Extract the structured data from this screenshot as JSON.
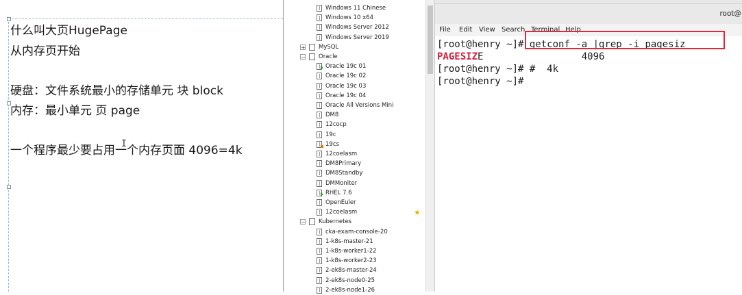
{
  "notes": {
    "lines": [
      "什么叫大页HugePage",
      "从内存页开始",
      "硬盘：文件系统最小的存储单元 块 block",
      "内存：最小单元 页 page",
      "一个程序最少要占用一个内存页面 4096=4k"
    ],
    "cursor_glyph": "I"
  },
  "tree": {
    "items": [
      {
        "label": "Windows 11 Chinese",
        "kind": "vm"
      },
      {
        "label": "Windows 10 x64",
        "kind": "vm"
      },
      {
        "label": "Windows Server 2012",
        "kind": "vm"
      },
      {
        "label": "Windows Server 2019",
        "kind": "vm"
      },
      {
        "label": "MySQL",
        "kind": "folder",
        "expander": "+"
      },
      {
        "label": "Oracle",
        "kind": "folder",
        "expander": "−"
      },
      {
        "label": "Oracle 19c 01",
        "kind": "vm",
        "state": "running"
      },
      {
        "label": "Oracle 19c 02",
        "kind": "vm"
      },
      {
        "label": "Oracle 19c 03",
        "kind": "vm"
      },
      {
        "label": "Oracle 19c 04",
        "kind": "vm"
      },
      {
        "label": "Oracle All Versions Mini",
        "kind": "vm"
      },
      {
        "label": "DM8",
        "kind": "vm"
      },
      {
        "label": "12cocp",
        "kind": "vm"
      },
      {
        "label": "19c",
        "kind": "vm"
      },
      {
        "label": "19cs",
        "kind": "vm",
        "state": "paused"
      },
      {
        "label": "12coelasm",
        "kind": "vm"
      },
      {
        "label": "DM8Primary",
        "kind": "vm"
      },
      {
        "label": "DM8Standby",
        "kind": "vm"
      },
      {
        "label": "DMMoniter",
        "kind": "vm"
      },
      {
        "label": "RHEL 7.6",
        "kind": "vm",
        "state": "running"
      },
      {
        "label": "OpenEuler",
        "kind": "vm"
      },
      {
        "label": "12coelasm",
        "kind": "vm"
      },
      {
        "label": "Kubernetes",
        "kind": "folder",
        "expander": "−"
      },
      {
        "label": "cka-exam-console-20",
        "kind": "vm"
      },
      {
        "label": "1-k8s-master-21",
        "kind": "vm"
      },
      {
        "label": "1-k8s-worker1-22",
        "kind": "vm"
      },
      {
        "label": "1-k8s-worker2-23",
        "kind": "vm"
      },
      {
        "label": "2-ek8s-master-24",
        "kind": "vm"
      },
      {
        "label": "2-ek8s-node0-25",
        "kind": "vm"
      },
      {
        "label": "2-ek8s-node1-26",
        "kind": "vm"
      }
    ],
    "favorite_icon": "star-icon"
  },
  "terminal": {
    "title": "root@",
    "menu": [
      "File",
      "Edit",
      "View",
      "Search",
      "Terminal",
      "Help"
    ],
    "lines": [
      {
        "prompt": "[root@henry ~]",
        "text": "# getconf -a |grep -i pagesiz"
      },
      {
        "highlight": "PAGESIZ",
        "rest": "E                 4096"
      },
      {
        "prompt": "[root@henry ~]",
        "text": "# #  4k"
      },
      {
        "prompt": "[root@henry ~]",
        "text": "#"
      }
    ],
    "highlight_color": "#e0283a"
  }
}
